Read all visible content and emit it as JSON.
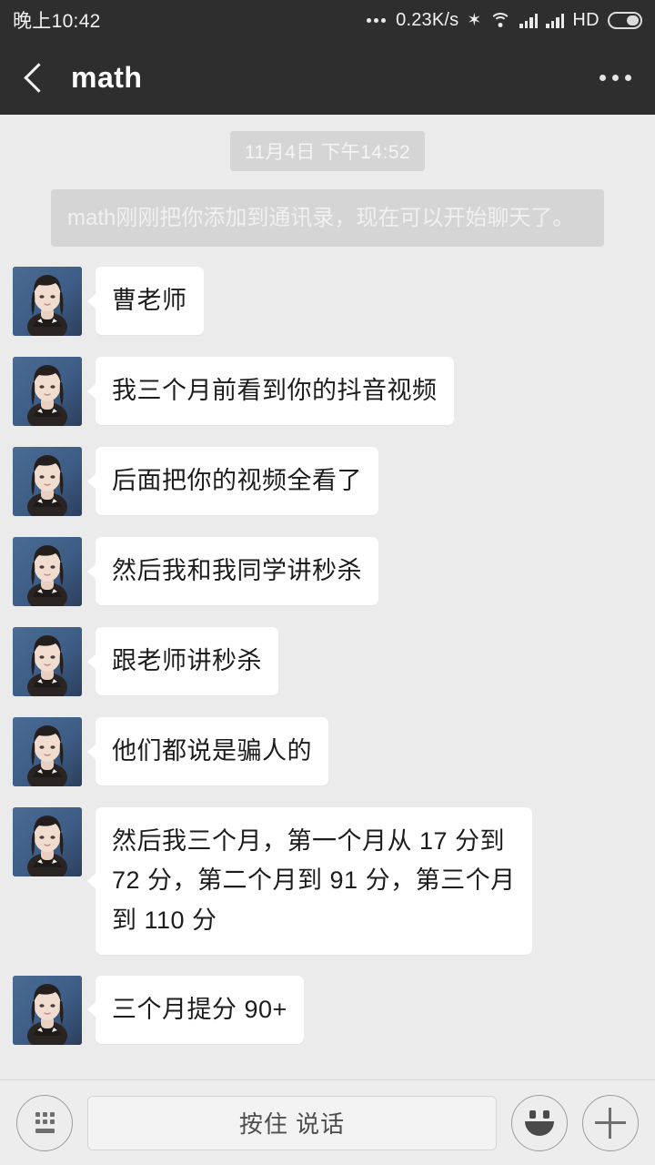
{
  "status_bar": {
    "clock": "晚上10:42",
    "net_speed": "0.23K/s",
    "bluetooth_icon": "bluetooth-icon",
    "wifi_icon": "wifi-icon",
    "signal_icon_1": "signal-bars-icon",
    "signal_icon_2": "signal-bars-icon",
    "hd_label": "HD",
    "battery_icon": "battery-icon"
  },
  "nav_bar": {
    "back_icon": "back-chevron-icon",
    "title": "math",
    "more_icon": "more-options-icon"
  },
  "chat": {
    "date_divider": "11月4日 下午14:52",
    "system_notice": "math刚刚把你添加到通讯录，现在可以开始聊天了。",
    "messages": [
      {
        "sender": "math",
        "text": "曹老师"
      },
      {
        "sender": "math",
        "text": "我三个月前看到你的抖音视频"
      },
      {
        "sender": "math",
        "text": "后面把你的视频全看了"
      },
      {
        "sender": "math",
        "text": "然后我和我同学讲秒杀"
      },
      {
        "sender": "math",
        "text": "跟老师讲秒杀"
      },
      {
        "sender": "math",
        "text": "他们都说是骗人的"
      },
      {
        "sender": "math",
        "text": "然后我三个月，第一个月从 17 分到 72 分，第二个月到 91 分，第三个月到 110 分"
      },
      {
        "sender": "math",
        "text": "三个月提分 90+"
      }
    ]
  },
  "input_bar": {
    "keyboard_icon": "keyboard-icon",
    "voice_button_label": "按住 说话",
    "emoji_icon": "smiley-icon",
    "plus_icon": "plus-icon"
  },
  "colors": {
    "header_bg": "#2e2e2e",
    "chat_bg": "#ebebeb",
    "bubble_bg": "#ffffff",
    "system_bg": "#d5d5d5",
    "input_bg": "#ededed",
    "text_primary": "#1c1c1c"
  }
}
